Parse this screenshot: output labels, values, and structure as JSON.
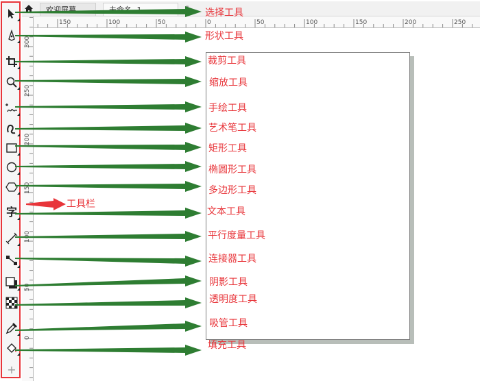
{
  "tabs": {
    "welcome": "欢迎屏幕",
    "untitled": "未命名 -1"
  },
  "ruler": {
    "top_ticks": [
      "150",
      "100",
      "50",
      "0",
      "50",
      "100",
      "150",
      "200",
      "250"
    ],
    "left_ticks": [
      "300",
      "250",
      "200",
      "150",
      "100",
      "50",
      "0"
    ]
  },
  "annotations": {
    "toolbar_label": "工具栏",
    "tools": [
      {
        "id": "pick",
        "label": "选择工具",
        "icon": "pointer-icon"
      },
      {
        "id": "shape",
        "label": "形状工具",
        "icon": "shape-node-icon"
      },
      {
        "id": "crop",
        "label": "裁剪工具",
        "icon": "crop-icon"
      },
      {
        "id": "zoom",
        "label": "缩放工具",
        "icon": "zoom-icon"
      },
      {
        "id": "freehand",
        "label": "手绘工具",
        "icon": "freehand-icon"
      },
      {
        "id": "artistic",
        "label": "艺术笔工具",
        "icon": "artistic-media-icon"
      },
      {
        "id": "rectangle",
        "label": "矩形工具",
        "icon": "rectangle-icon"
      },
      {
        "id": "ellipse",
        "label": "椭圆形工具",
        "icon": "ellipse-icon"
      },
      {
        "id": "polygon",
        "label": "多边形工具",
        "icon": "polygon-icon"
      },
      {
        "id": "text",
        "label": "文本工具",
        "icon": "text-icon"
      },
      {
        "id": "parallel",
        "label": "平行度量工具",
        "icon": "dimension-icon"
      },
      {
        "id": "connector",
        "label": "连接器工具",
        "icon": "connector-icon"
      },
      {
        "id": "shadow",
        "label": "阴影工具",
        "icon": "drop-shadow-icon"
      },
      {
        "id": "transparency",
        "label": "透明度工具",
        "icon": "transparency-icon"
      },
      {
        "id": "eyedropper",
        "label": "吸管工具",
        "icon": "eyedropper-icon"
      },
      {
        "id": "fill",
        "label": "填充工具",
        "icon": "fill-icon"
      }
    ]
  },
  "text_tool_glyph": "字",
  "add_tool_glyph": "+",
  "colors": {
    "highlight": "#e8353a",
    "arrow": "#2e7d32",
    "page_shadow": "#b8beb9"
  }
}
